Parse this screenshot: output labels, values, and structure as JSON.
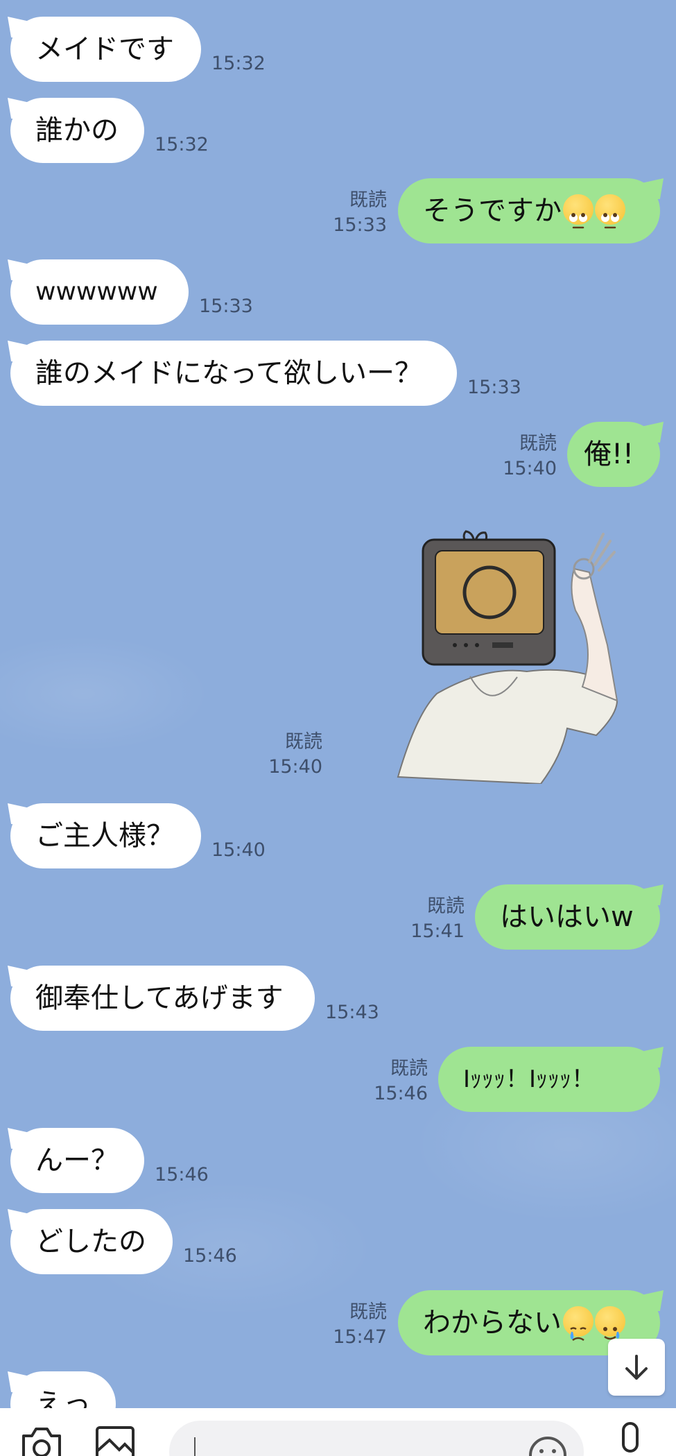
{
  "messages": [
    {
      "side": "in",
      "text": "メイドです",
      "time": "15:32"
    },
    {
      "side": "in",
      "text": "誰かの",
      "time": "15:32"
    },
    {
      "side": "out",
      "text": "そうですか",
      "read": "既読",
      "time": "15:33",
      "emojis": [
        "face-with-rolling-eyes",
        "face-with-rolling-eyes"
      ]
    },
    {
      "side": "in",
      "text": "wwwwww",
      "time": "15:33"
    },
    {
      "side": "in",
      "text": "誰のメイドになって欲しいー？",
      "time": "15:33"
    },
    {
      "side": "out",
      "text": "俺!!",
      "read": "既読",
      "time": "15:40"
    },
    {
      "side": "out",
      "type": "sticker",
      "sticker": "tv-head-ok-hand-sticker",
      "read": "既読",
      "time": "15:40"
    },
    {
      "side": "in",
      "text": "ご主人様？",
      "time": "15:40"
    },
    {
      "side": "out",
      "text": "はいはいw",
      "read": "既読",
      "time": "15:41"
    },
    {
      "side": "in",
      "text": "御奉仕してあげます",
      "time": "15:43"
    },
    {
      "side": "out",
      "text": "Iｯｯｯ！Iｯｯｯ！",
      "read": "既読",
      "time": "15:46"
    },
    {
      "side": "in",
      "text": "んー？",
      "time": "15:46"
    },
    {
      "side": "in",
      "text": "どしたの",
      "time": "15:46"
    },
    {
      "side": "out",
      "text": "わからない",
      "read": "既読",
      "time": "15:47",
      "emojis": [
        "crying-face",
        "smiling-face-with-tear"
      ]
    },
    {
      "side": "in",
      "text": "えっ",
      "time": ""
    }
  ],
  "toolbar": {
    "camera_icon": "camera-icon",
    "image_icon": "image-icon",
    "emoji_icon": "emoji-icon",
    "mic_icon": "microphone-icon",
    "scroll_icon": "arrow-down-icon"
  },
  "colors": {
    "background": "#8daddc",
    "incoming_bubble": "#ffffff",
    "outgoing_bubble": "#9fe492",
    "meta_text": "#3e4f6b"
  }
}
